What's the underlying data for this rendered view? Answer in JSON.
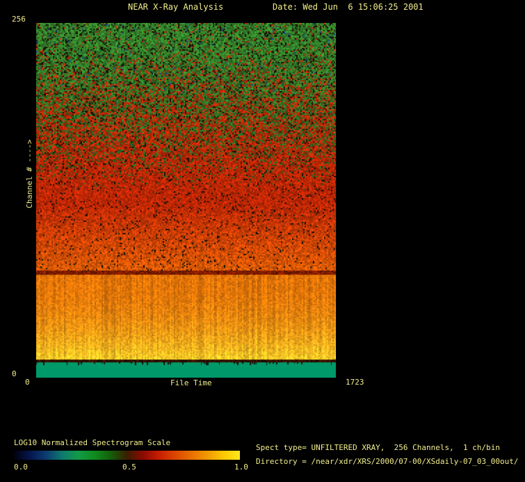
{
  "window": {
    "bg": "#000000",
    "text_color": "#F2EE8C"
  },
  "header": {
    "title": "NEAR X-Ray Analysis",
    "date": "Date: Wed Jun  6 15:06:25 2001"
  },
  "chart_data": {
    "type": "heatmap",
    "title": "NEAR X-Ray Analysis",
    "xlabel": "File Time",
    "ylabel": "Channel # ---->",
    "x_range": [
      0,
      1723
    ],
    "y_range": [
      0,
      256
    ],
    "x_tick_labels": [
      "0",
      "1723"
    ],
    "y_tick_labels": [
      "0",
      "256"
    ],
    "grid": "off",
    "frame": "none",
    "noise_seed": 1323867,
    "bands": [
      {
        "name": "baseline-band",
        "channels": [
          0,
          11
        ],
        "style": "solid",
        "color": "#00996A",
        "desc": "flat teal-green band at bottom with sparse tiny dark ticks on its upper edge"
      },
      {
        "name": "dark-separator",
        "channels": [
          11,
          13
        ],
        "style": "dark",
        "color": "#3C1400",
        "desc": "thin dark line between baseline band and orange band"
      },
      {
        "name": "orange-band",
        "channels": [
          13,
          74
        ],
        "style": "streak",
        "color_top": "#E67608",
        "color_bottom": "#FFD028",
        "desc": "bright orange band with vertical streaks, brightening to yellow at its bottom edge"
      },
      {
        "name": "dark-red-line",
        "channels": [
          74,
          77
        ],
        "style": "dark",
        "color": "#821C00",
        "desc": "thin dark red line at top of orange band"
      },
      {
        "name": "speckle-gradient",
        "channels": [
          77,
          256
        ],
        "style": "speckle",
        "red": "#C32805",
        "green": "#2D871E",
        "dark": "#0A0A05",
        "blue": "#144696",
        "desc": "noisy speckle field: solid red at lower channels grading to green with dark speckles at high channels"
      }
    ],
    "colorbar": {
      "label": "LOG10 Normalized Spectrogram Scale",
      "ticks": [
        "0.0",
        "0.5",
        "1.0"
      ],
      "stops": [
        "#01010C",
        "#06164E",
        "#0C3C70",
        "#0E7A6E",
        "#129A46",
        "#0F8C1E",
        "#145F0A",
        "#3A1E00",
        "#8C0A00",
        "#C81E00",
        "#DC4600",
        "#E87000",
        "#F09A00",
        "#FCC800",
        "#FFE81E"
      ],
      "legend_position": "bottom-left"
    }
  },
  "footer": {
    "spect_line": "Spect type= UNFILTERED XRAY,  256 Channels,  1 ch/bin",
    "directory_line": "Directory = /near/xdr/XRS/2000/07-00/XSdaily-07_03_00out/"
  }
}
